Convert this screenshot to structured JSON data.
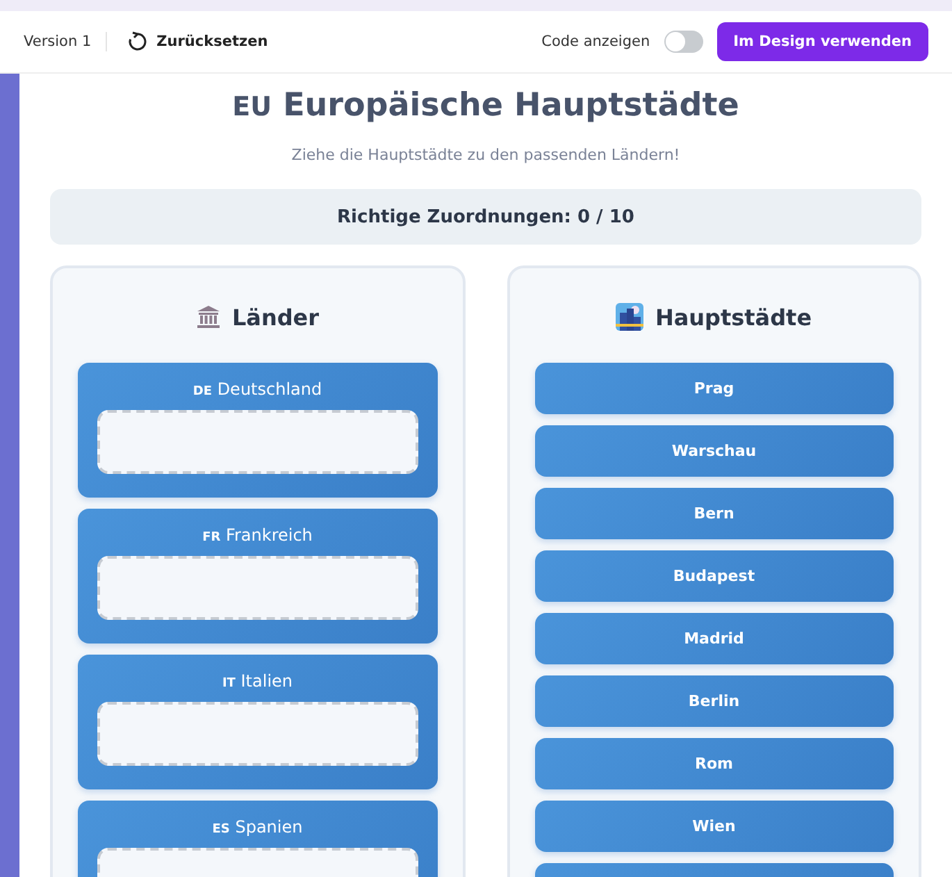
{
  "toolbar": {
    "version": "Version 1",
    "reset": "Zurücksetzen",
    "code_label": "Code anzeigen",
    "code_on": false,
    "use_button": "Im Design verwenden"
  },
  "title": {
    "badge": "EU",
    "text": "Europäische Hauptstädte"
  },
  "subtitle": "Ziehe die Hauptstädte zu den passenden Ländern!",
  "score": "Richtige Zuordnungen: 0 / 10",
  "countries_panel": {
    "heading": "Länder",
    "countries": [
      {
        "code": "DE",
        "name": "Deutschland"
      },
      {
        "code": "FR",
        "name": "Frankreich"
      },
      {
        "code": "IT",
        "name": "Italien"
      },
      {
        "code": "ES",
        "name": "Spanien"
      }
    ]
  },
  "cities_panel": {
    "heading": "Hauptstädte",
    "cities": [
      "Prag",
      "Warschau",
      "Bern",
      "Budapest",
      "Madrid",
      "Berlin",
      "Rom",
      "Wien"
    ]
  }
}
